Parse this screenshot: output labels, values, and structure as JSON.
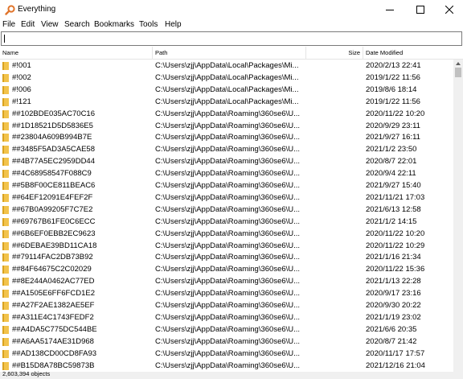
{
  "window": {
    "title": "Everything",
    "app_icon": "magnifier-icon",
    "controls": [
      "minimize-icon",
      "maximize-icon",
      "close-icon"
    ]
  },
  "menu": [
    "File",
    "Edit",
    "View",
    "Search",
    "Bookmarks",
    "Tools",
    "Help"
  ],
  "search": {
    "value": "",
    "placeholder": ""
  },
  "columns": {
    "name": "Name",
    "path": "Path",
    "size": "Size",
    "date": "Date Modified"
  },
  "rows": [
    {
      "name": "#!001",
      "path": "C:\\Users\\zjj\\AppData\\Local\\Packages\\Mi...",
      "date": "2020/2/13 22:41"
    },
    {
      "name": "#!002",
      "path": "C:\\Users\\zjj\\AppData\\Local\\Packages\\Mi...",
      "date": "2019/1/22 11:56"
    },
    {
      "name": "#!006",
      "path": "C:\\Users\\zjj\\AppData\\Local\\Packages\\Mi...",
      "date": "2019/8/6 18:14"
    },
    {
      "name": "#!121",
      "path": "C:\\Users\\zjj\\AppData\\Local\\Packages\\Mi...",
      "date": "2019/1/22 11:56"
    },
    {
      "name": "##102BDE035AC70C16",
      "path": "C:\\Users\\zjj\\AppData\\Roaming\\360se6\\U...",
      "date": "2020/11/22 10:20"
    },
    {
      "name": "##1D18521D5D5836E5",
      "path": "C:\\Users\\zjj\\AppData\\Roaming\\360se6\\U...",
      "date": "2020/9/29 23:11"
    },
    {
      "name": "##23804A609B994B7E",
      "path": "C:\\Users\\zjj\\AppData\\Roaming\\360se6\\U...",
      "date": "2021/9/27 16:11"
    },
    {
      "name": "##3485F5AD3A5CAE58",
      "path": "C:\\Users\\zjj\\AppData\\Roaming\\360se6\\U...",
      "date": "2021/1/2 23:50"
    },
    {
      "name": "##4B77A5EC2959DD44",
      "path": "C:\\Users\\zjj\\AppData\\Roaming\\360se6\\U...",
      "date": "2020/8/7 22:01"
    },
    {
      "name": "##4C68958547F088C9",
      "path": "C:\\Users\\zjj\\AppData\\Roaming\\360se6\\U...",
      "date": "2020/9/4 22:11"
    },
    {
      "name": "##5B8F00CE811BEAC6",
      "path": "C:\\Users\\zjj\\AppData\\Roaming\\360se6\\U...",
      "date": "2021/9/27 15:40"
    },
    {
      "name": "##64EF12091E4FEF2F",
      "path": "C:\\Users\\zjj\\AppData\\Roaming\\360se6\\U...",
      "date": "2021/11/21 17:03"
    },
    {
      "name": "##67B0A99205F7C7E2",
      "path": "C:\\Users\\zjj\\AppData\\Roaming\\360se6\\U...",
      "date": "2021/6/13 12:58"
    },
    {
      "name": "##69767B61FE0C6ECC",
      "path": "C:\\Users\\zjj\\AppData\\Roaming\\360se6\\U...",
      "date": "2021/1/2 14:15"
    },
    {
      "name": "##6B6EF0EBB2EC9623",
      "path": "C:\\Users\\zjj\\AppData\\Roaming\\360se6\\U...",
      "date": "2020/11/22 10:20"
    },
    {
      "name": "##6DEBAE39BD11CA18",
      "path": "C:\\Users\\zjj\\AppData\\Roaming\\360se6\\U...",
      "date": "2020/11/22 10:29"
    },
    {
      "name": "##79114FAC2DB73B92",
      "path": "C:\\Users\\zjj\\AppData\\Roaming\\360se6\\U...",
      "date": "2021/1/16 21:34"
    },
    {
      "name": "##84F64675C2C02029",
      "path": "C:\\Users\\zjj\\AppData\\Roaming\\360se6\\U...",
      "date": "2020/11/22 15:36"
    },
    {
      "name": "##8E244A0462AC77ED",
      "path": "C:\\Users\\zjj\\AppData\\Roaming\\360se6\\U...",
      "date": "2021/1/13 22:28"
    },
    {
      "name": "##A1505E6FF6FCD1E2",
      "path": "C:\\Users\\zjj\\AppData\\Roaming\\360se6\\U...",
      "date": "2020/9/17 23:16"
    },
    {
      "name": "##A27F2AE1382AE5EF",
      "path": "C:\\Users\\zjj\\AppData\\Roaming\\360se6\\U...",
      "date": "2020/9/30 20:22"
    },
    {
      "name": "##A311E4C1743FEDF2",
      "path": "C:\\Users\\zjj\\AppData\\Roaming\\360se6\\U...",
      "date": "2021/1/19 23:02"
    },
    {
      "name": "##A4DA5C775DC544BE",
      "path": "C:\\Users\\zjj\\AppData\\Roaming\\360se6\\U...",
      "date": "2021/6/6 20:35"
    },
    {
      "name": "##A6AA5174AE31D968",
      "path": "C:\\Users\\zjj\\AppData\\Roaming\\360se6\\U...",
      "date": "2020/8/7 21:42"
    },
    {
      "name": "##AD138CD00CD8FA93",
      "path": "C:\\Users\\zjj\\AppData\\Roaming\\360se6\\U...",
      "date": "2020/11/17 17:57"
    },
    {
      "name": "##B15D8A78BC59873B",
      "path": "C:\\Users\\zjj\\AppData\\Roaming\\360se6\\U...",
      "date": "2021/12/16 21:04"
    }
  ],
  "status": {
    "text": "2,603,394 objects"
  },
  "colors": {
    "folder": "#f2c34c",
    "folder_dark": "#d9a21f",
    "app_icon": "#e0742a"
  }
}
